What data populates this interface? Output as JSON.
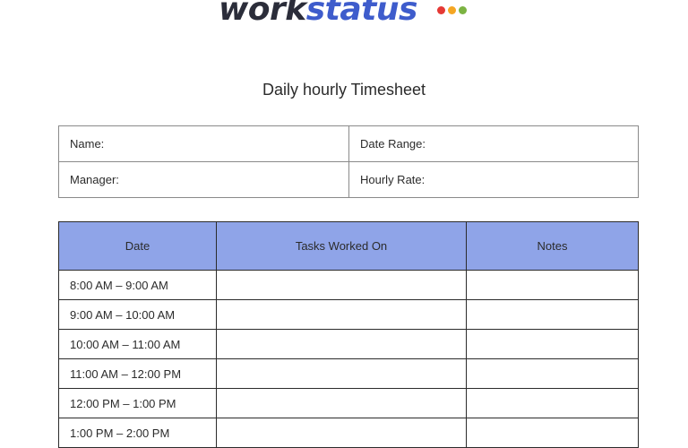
{
  "logo": {
    "part1": "work",
    "part2": "status",
    "dot_colors": [
      "#e53935",
      "#f5a623",
      "#7cb342"
    ]
  },
  "title": "Daily hourly Timesheet",
  "info": {
    "name_label": "Name:",
    "date_range_label": "Date Range:",
    "manager_label": "Manager:",
    "hourly_rate_label": "Hourly Rate:"
  },
  "table": {
    "headers": [
      "Date",
      "Tasks Worked On",
      "Notes"
    ],
    "header_bg": "#8fa4e8",
    "rows": [
      "8:00 AM – 9:00 AM",
      "9:00 AM – 10:00 AM",
      "10:00 AM – 11:00 AM",
      "11:00 AM – 12:00 PM",
      "12:00 PM – 1:00 PM",
      "1:00 PM – 2:00 PM"
    ]
  }
}
